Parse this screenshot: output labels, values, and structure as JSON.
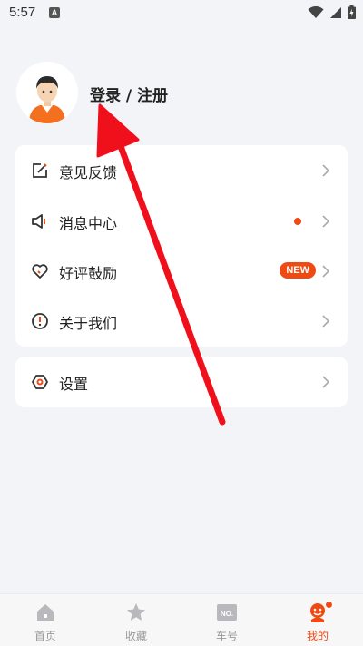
{
  "status_bar": {
    "time": "5:57",
    "notification_icon": "a-notification-icon",
    "wifi_icon": "wifi-icon",
    "signal_icon": "signal-icon",
    "battery_icon": "battery-charging-icon"
  },
  "profile": {
    "login_label": "登录 / 注册",
    "avatar_icon": "user-avatar-icon"
  },
  "menu": {
    "items": [
      {
        "label": "意见反馈",
        "icon": "feedback-edit-icon"
      },
      {
        "label": "消息中心",
        "icon": "speaker-icon",
        "has_red_dot": true
      },
      {
        "label": "好评鼓励",
        "icon": "heart-icon",
        "badge": "NEW"
      },
      {
        "label": "关于我们",
        "icon": "info-alert-icon"
      }
    ],
    "settings": {
      "label": "设置",
      "icon": "settings-hex-icon"
    }
  },
  "tab_bar": {
    "tabs": [
      {
        "label": "首页",
        "icon": "home-icon",
        "active": false
      },
      {
        "label": "收藏",
        "icon": "star-icon",
        "active": false
      },
      {
        "label": "车号",
        "icon": "plate-number-icon",
        "icon_text": "NO.",
        "active": false
      },
      {
        "label": "我的",
        "icon": "profile-mascot-icon",
        "active": true
      }
    ]
  },
  "colors": {
    "accent": "#ef4a13",
    "annotation_arrow": "#f0101c",
    "background": "#f3f4f8"
  }
}
